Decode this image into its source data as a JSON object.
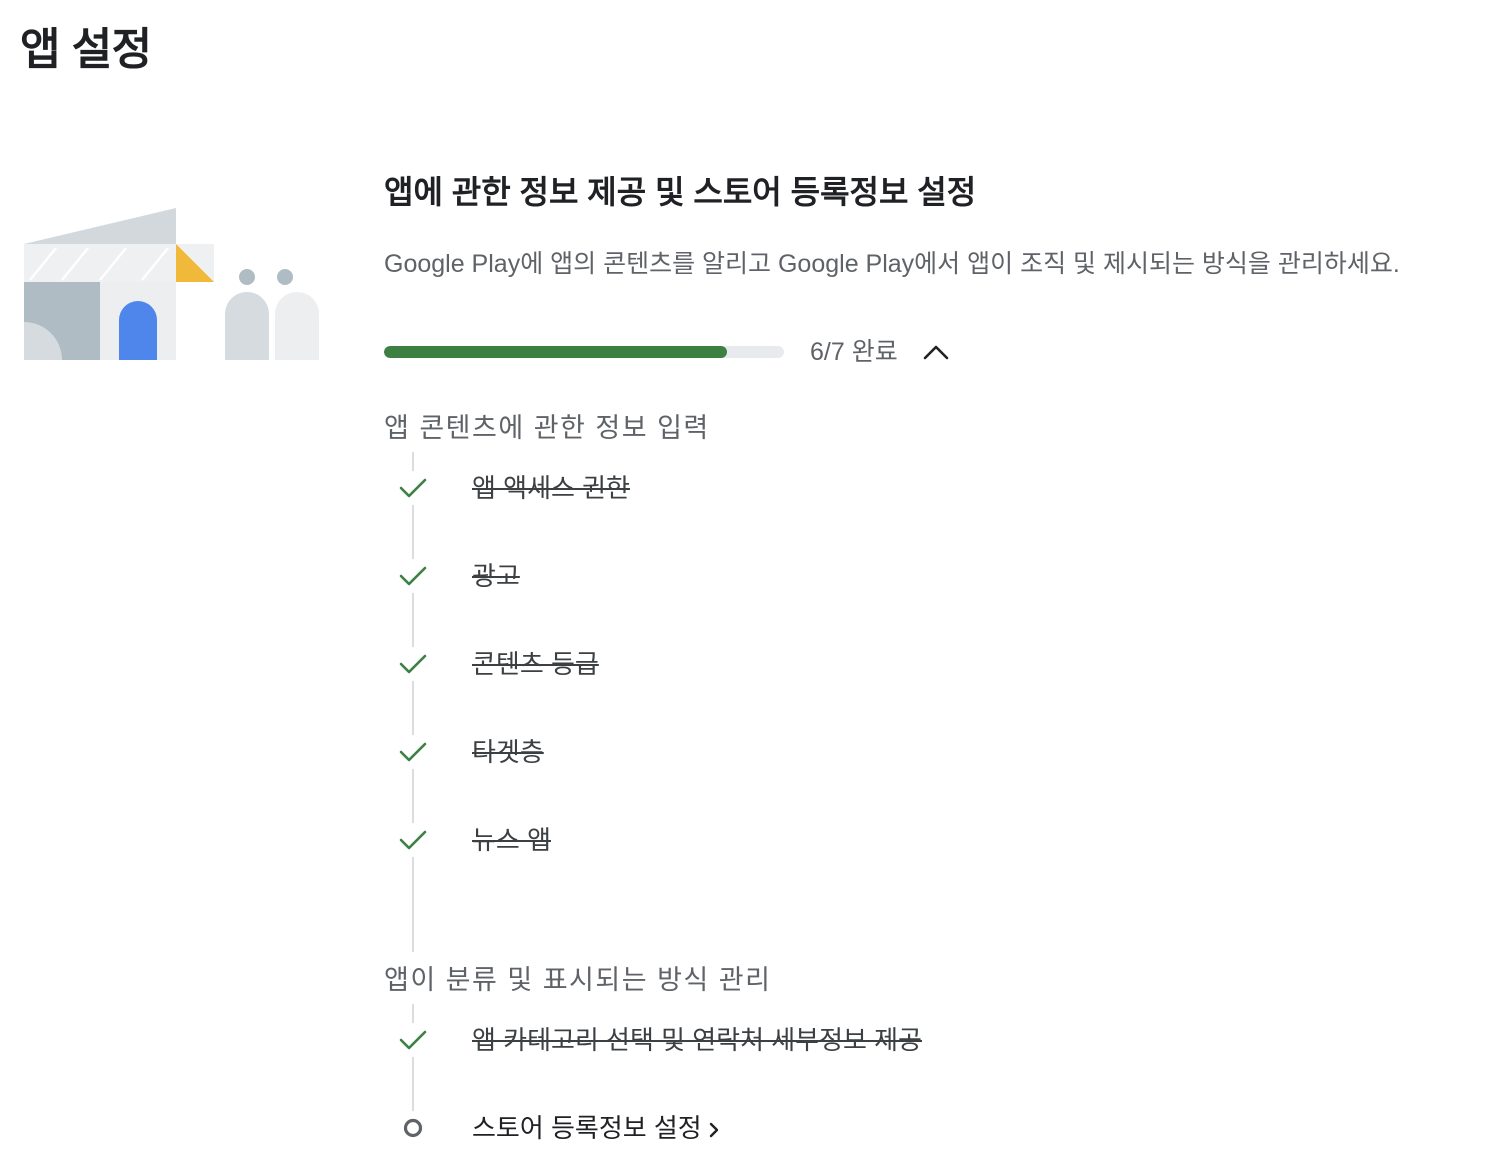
{
  "page": {
    "title": "앱 설정"
  },
  "setup_card": {
    "heading": "앱에 관한 정보 제공 및 스토어 등록정보 설정",
    "description": "Google Play에 앱의 콘텐츠를 알리고 Google Play에서 앱이 조직 및 제시되는 방식을 관리하세요.",
    "progress": {
      "completed": 6,
      "total": 7,
      "fraction": 0.857,
      "label": "6/7 완료",
      "bar_color": "#3c8042",
      "track_color": "#e8eaed",
      "toggle_icon": "chevron-up-icon"
    },
    "groups": [
      {
        "title": "앱 콘텐츠에 관한 정보 입력",
        "tasks": [
          {
            "label": "앱 액세스 권한",
            "status": "done",
            "icon": "check-icon"
          },
          {
            "label": "광고",
            "status": "done",
            "icon": "check-icon"
          },
          {
            "label": "콘텐츠 등급",
            "status": "done",
            "icon": "check-icon"
          },
          {
            "label": "타겟층",
            "status": "done",
            "icon": "check-icon"
          },
          {
            "label": "뉴스 앱",
            "status": "done",
            "icon": "check-icon"
          }
        ]
      },
      {
        "title": "앱이 분류 및 표시되는 방식 관리",
        "tasks": [
          {
            "label": "앱 카테고리 선택 및 연락처 세부정보 제공",
            "status": "done",
            "icon": "check-icon"
          },
          {
            "label": "스토어 등록정보 설정",
            "status": "pending",
            "icon": "empty-circle-icon",
            "trailing_icon": "chevron-right-icon"
          }
        ]
      }
    ],
    "colors": {
      "check": "#3c8042",
      "pending_circle": "#5f6368",
      "illustration_blue": "#4f86ec",
      "illustration_yellow": "#f0b93a"
    }
  }
}
